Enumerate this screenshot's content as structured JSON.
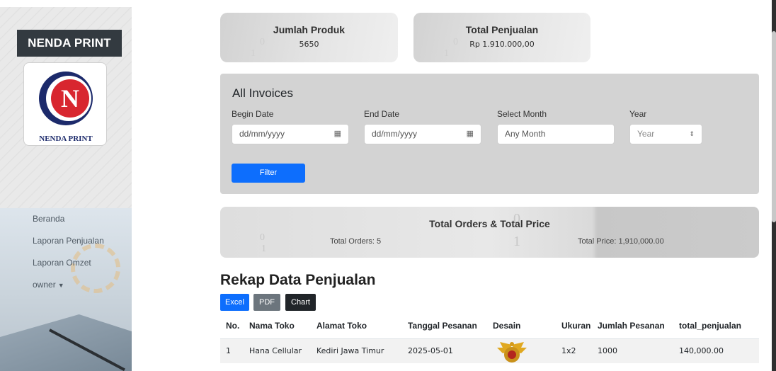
{
  "sidebar": {
    "brand": "NENDA PRINT",
    "logo_text": "NENDA PRINT",
    "nav": [
      {
        "label": "Beranda"
      },
      {
        "label": "Laporan Penjualan"
      },
      {
        "label": "Laporan Omzet"
      },
      {
        "label": "owner"
      }
    ]
  },
  "cards": {
    "products": {
      "title": "Jumlah Produk",
      "value": "5650"
    },
    "sales": {
      "title": "Total Penjualan",
      "value": "Rp 1.910.000,00"
    }
  },
  "filter": {
    "heading": "All Invoices",
    "begin_label": "Begin Date",
    "begin_placeholder": "dd/mm/yyyy",
    "end_label": "End Date",
    "end_placeholder": "dd/mm/yyyy",
    "month_label": "Select Month",
    "month_value": "Any Month",
    "year_label": "Year",
    "year_value": "Year",
    "button": "Filter"
  },
  "totals": {
    "title": "Total Orders & Total Price",
    "orders": "Total Orders: 5",
    "price": "Total Price: 1,910,000.00"
  },
  "report": {
    "title": "Rekap Data Penjualan",
    "excel": "Excel",
    "pdf": "PDF",
    "chart": "Chart",
    "columns": [
      "No.",
      "Nama Toko",
      "Alamat Toko",
      "Tanggal Pesanan",
      "Desain",
      "Ukuran",
      "Jumlah Pesanan",
      "total_penjualan"
    ],
    "rows": [
      {
        "no": "1",
        "toko": "Hana Cellular",
        "alamat": "Kediri Jawa Timur",
        "tanggal": "2025-05-01",
        "ukuran": "1x2",
        "jumlah": "1000",
        "total": "140,000.00"
      }
    ]
  },
  "colors": {
    "primary": "#0d6efd",
    "secondary": "#6c757d",
    "dark": "#212529",
    "brand_red": "#d8262f",
    "brand_navy": "#1c2a6b"
  }
}
